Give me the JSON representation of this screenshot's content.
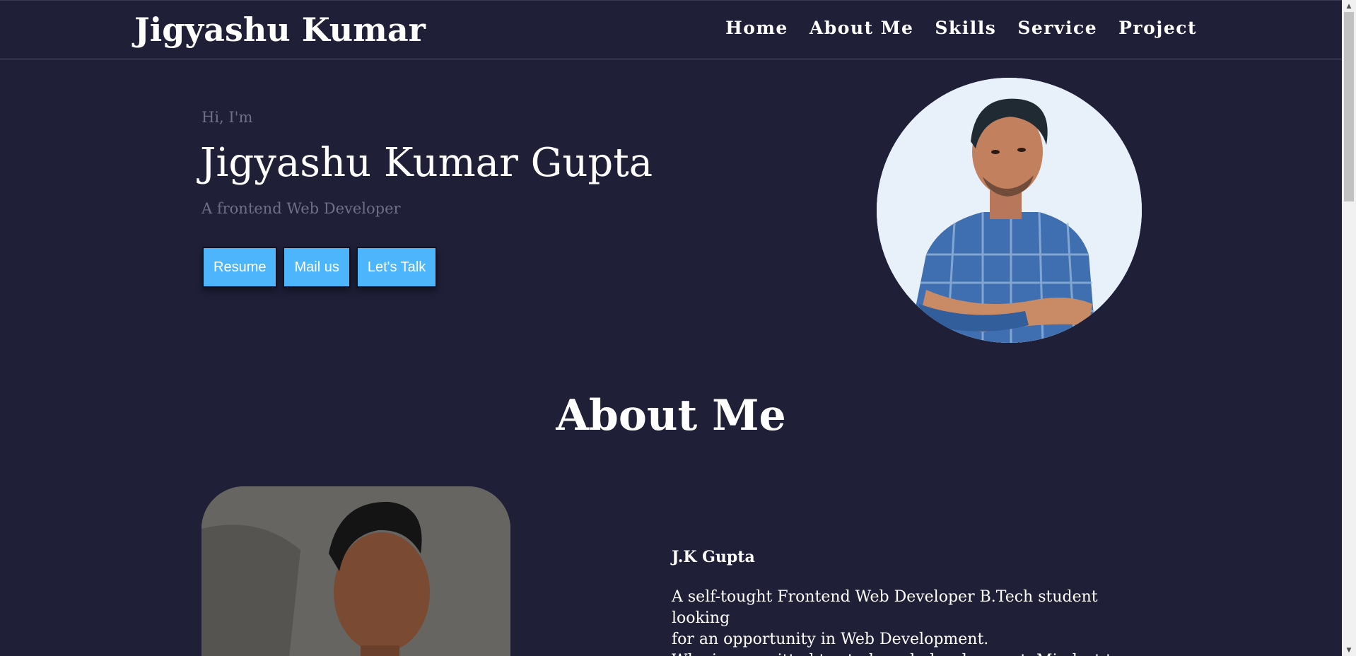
{
  "nav": {
    "brand": "Jigyashu Kumar",
    "links": [
      "Home",
      "About Me",
      "Skills",
      "Service",
      "Project"
    ]
  },
  "hero": {
    "greeting": "Hi, I'm",
    "name": "Jigyashu Kumar Gupta",
    "role": "A frontend Web Developer",
    "buttons": [
      "Resume",
      "Mail us",
      "Let's Talk"
    ]
  },
  "about": {
    "heading": "About Me",
    "name": "J.K Gupta",
    "lines": [
      "A self-tought Frontend Web Developer B.Tech student looking",
      "for an opportunity in Web Development.",
      "Who is committed to study web development. Mindset to"
    ]
  },
  "colors": {
    "background": "#1f1f38",
    "button": "#4db5fb",
    "muted_text": "#6f6f88"
  }
}
